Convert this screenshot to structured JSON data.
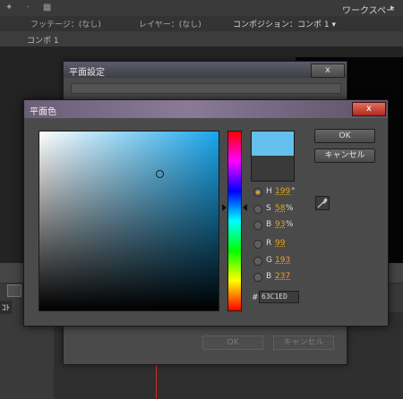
{
  "app": {
    "top_icons": "✦ · ▦",
    "workspace_label": "ワークスペース：",
    "workspace_arrow": "▸",
    "panel_tabs": [
      {
        "label": "フッテージ：(なし)"
      },
      {
        "label": "レイヤー：(なし)"
      },
      {
        "label": "コンポジション：コンポ 1 ▾"
      }
    ],
    "comp_name": "コンポ 1",
    "timeline_label": "ｺﾄ"
  },
  "solid_dialog": {
    "title": "平面設定",
    "close_label": "x",
    "ok_label": "OK",
    "cancel_label": "キャンセル"
  },
  "color_dialog": {
    "title": "平面色",
    "close_label": "x",
    "ok_label": "OK",
    "cancel_label": "キャンセル",
    "new_color": "#63C1ED",
    "current_color": "#3a3a3a",
    "field_hue_color": "#19a6ec",
    "hsb": [
      {
        "label": "H",
        "value": "199",
        "unit": "°",
        "selected": true
      },
      {
        "label": "S",
        "value": "58",
        "unit": "%",
        "selected": false
      },
      {
        "label": "B",
        "value": "93",
        "unit": "%",
        "selected": false
      }
    ],
    "rgb": [
      {
        "label": "R",
        "value": "99",
        "unit": "",
        "selected": false
      },
      {
        "label": "G",
        "value": "193",
        "unit": "",
        "selected": false
      },
      {
        "label": "B",
        "value": "237",
        "unit": "",
        "selected": false
      }
    ],
    "hex_prefix": "#",
    "hex_value": "63C1ED",
    "eyedropper_icon": "eyedropper-icon"
  }
}
